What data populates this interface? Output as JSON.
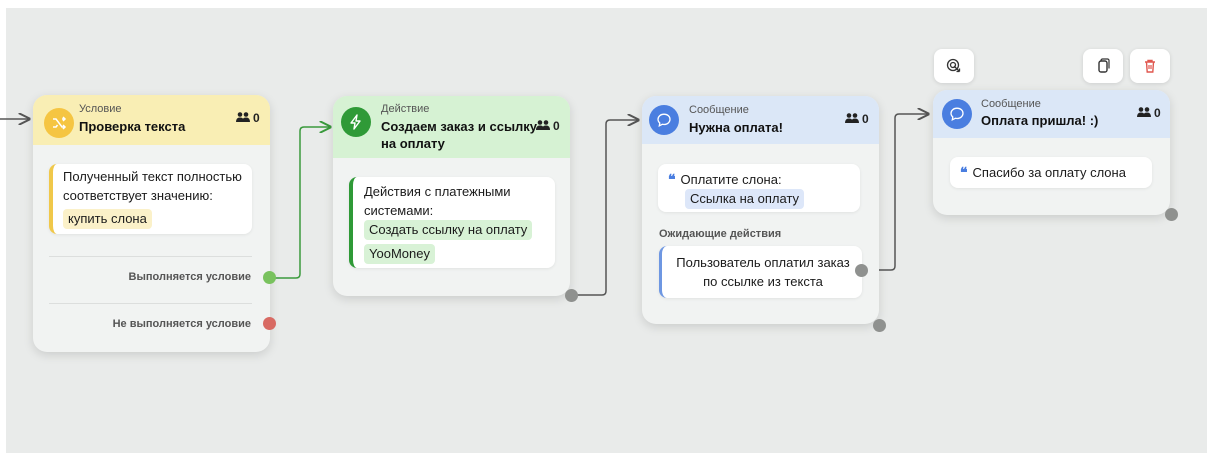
{
  "nodes": [
    {
      "type_label": "Условие",
      "title": "Проверка текста",
      "count": "0",
      "body_text": "Полученный текст полностью соответствует значению:",
      "value_chip": "купить слона",
      "outputs": [
        "Выполняется условие",
        "Не выполняется условие"
      ]
    },
    {
      "type_label": "Действие",
      "title": "Создаем заказ и ссылку на оплату",
      "count": "0",
      "body_text": "Действия с платежными системами:",
      "chips": [
        "Создать ссылку на оплату",
        "YooMoney"
      ]
    },
    {
      "type_label": "Сообщение",
      "title": "Нужна оплата!",
      "count": "0",
      "message_text": "Оплатите слона:",
      "message_chip": "Ссылка на оплату",
      "pending_label": "Ожидающие действия",
      "pending_text": "Пользователь оплатил заказ по ссылке из текста"
    },
    {
      "type_label": "Сообщение",
      "title": "Оплата пришла! :)",
      "count": "0",
      "message_text": "Спасибо за оплату слона"
    }
  ],
  "quote_mark": "❝",
  "toolbar": [
    "target-icon",
    "copy-icon",
    "trash-icon"
  ],
  "colors": {
    "condition": "#f5c542",
    "action": "#2f9a37",
    "message": "#4a7ee0",
    "port_success": "#79c25e",
    "port_fail": "#d86a63",
    "trash": "#e0574f"
  }
}
